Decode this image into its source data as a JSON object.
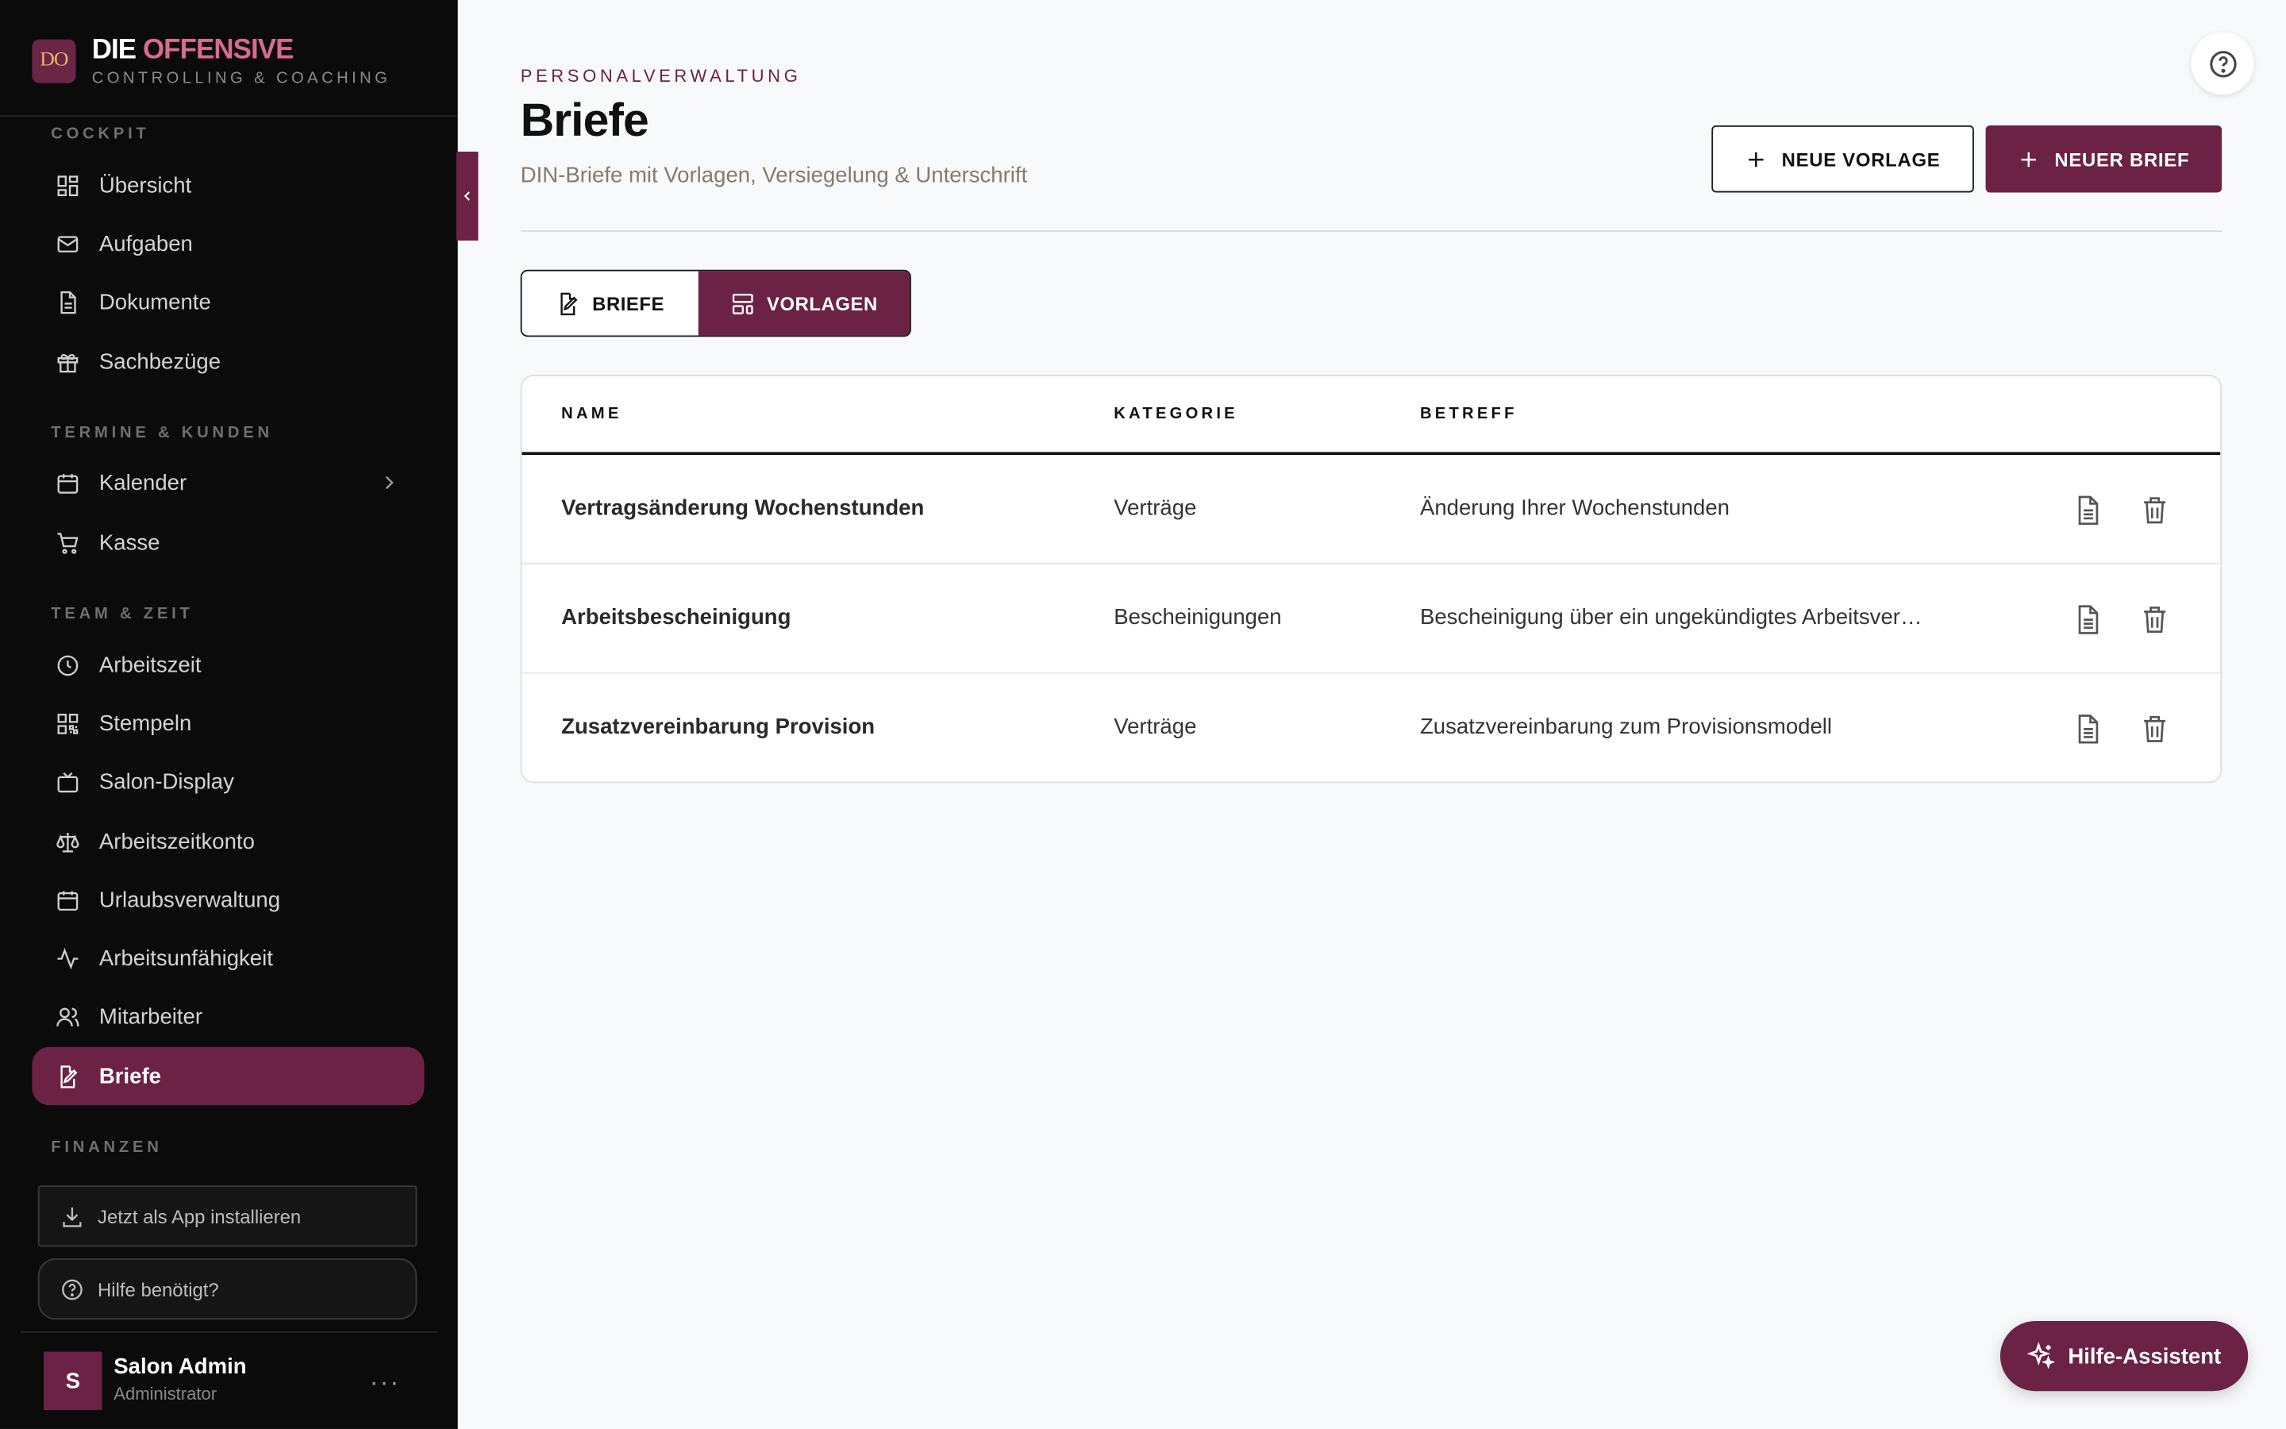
{
  "brand": {
    "logo": "DO",
    "title_part1": "DIE",
    "title_part2": "OFFENSIVE",
    "subtitle": "CONTROLLING & COACHING"
  },
  "sidebar": {
    "sections": [
      {
        "label": "COCKPIT"
      },
      {
        "label": "TERMINE & KUNDEN"
      },
      {
        "label": "TEAM & ZEIT"
      },
      {
        "label": "FINANZEN"
      }
    ],
    "items": [
      {
        "label": "Übersicht",
        "icon": "dashboard-icon"
      },
      {
        "label": "Aufgaben",
        "icon": "mail-icon"
      },
      {
        "label": "Dokumente",
        "icon": "document-icon"
      },
      {
        "label": "Sachbezüge",
        "icon": "gift-icon"
      },
      {
        "label": "Kalender",
        "icon": "calendar-icon"
      },
      {
        "label": "Kasse",
        "icon": "cart-icon"
      },
      {
        "label": "Arbeitszeit",
        "icon": "clock-icon"
      },
      {
        "label": "Stempeln",
        "icon": "qr-icon"
      },
      {
        "label": "Salon-Display",
        "icon": "tv-icon"
      },
      {
        "label": "Arbeitszeitkonto",
        "icon": "scale-icon"
      },
      {
        "label": "Urlaubsverwaltung",
        "icon": "calendar-icon"
      },
      {
        "label": "Arbeitsunfähigkeit",
        "icon": "activity-icon"
      },
      {
        "label": "Mitarbeiter",
        "icon": "users-icon"
      },
      {
        "label": "Briefe",
        "icon": "edit-document-icon",
        "active": true
      }
    ],
    "install_label": "Jetzt als App installieren",
    "help_label": "Hilfe benötigt?",
    "user": {
      "initial": "S",
      "name": "Salon Admin",
      "role": "Administrator",
      "more": "···"
    }
  },
  "header": {
    "overline": "PERSONALVERWALTUNG",
    "title": "Briefe",
    "subtitle": "DIN-Briefe mit Vorlagen, Versiegelung & Unterschrift",
    "new_template_label": "NEUE VORLAGE",
    "new_letter_label": "NEUER BRIEF"
  },
  "tabs": [
    {
      "label": "BRIEFE",
      "active": false
    },
    {
      "label": "VORLAGEN",
      "active": true
    }
  ],
  "table": {
    "columns": [
      "NAME",
      "KATEGORIE",
      "BETREFF"
    ],
    "rows": [
      {
        "name": "Vertragsänderung Wochenstunden",
        "category": "Verträge",
        "subject": "Änderung Ihrer Wochenstunden"
      },
      {
        "name": "Arbeitsbescheinigung",
        "category": "Bescheinigungen",
        "subject": "Bescheinigung über ein ungekündigtes Arbeitsver…"
      },
      {
        "name": "Zusatzvereinbarung Provision",
        "category": "Verträge",
        "subject": "Zusatzvereinbarung zum Provisionsmodell"
      }
    ]
  },
  "assistant_label": "Hilfe-Assistent",
  "colors": {
    "accent": "#6b2245",
    "brand_pink": "#d96b8f",
    "sidebar_bg": "#0b0b0b"
  }
}
